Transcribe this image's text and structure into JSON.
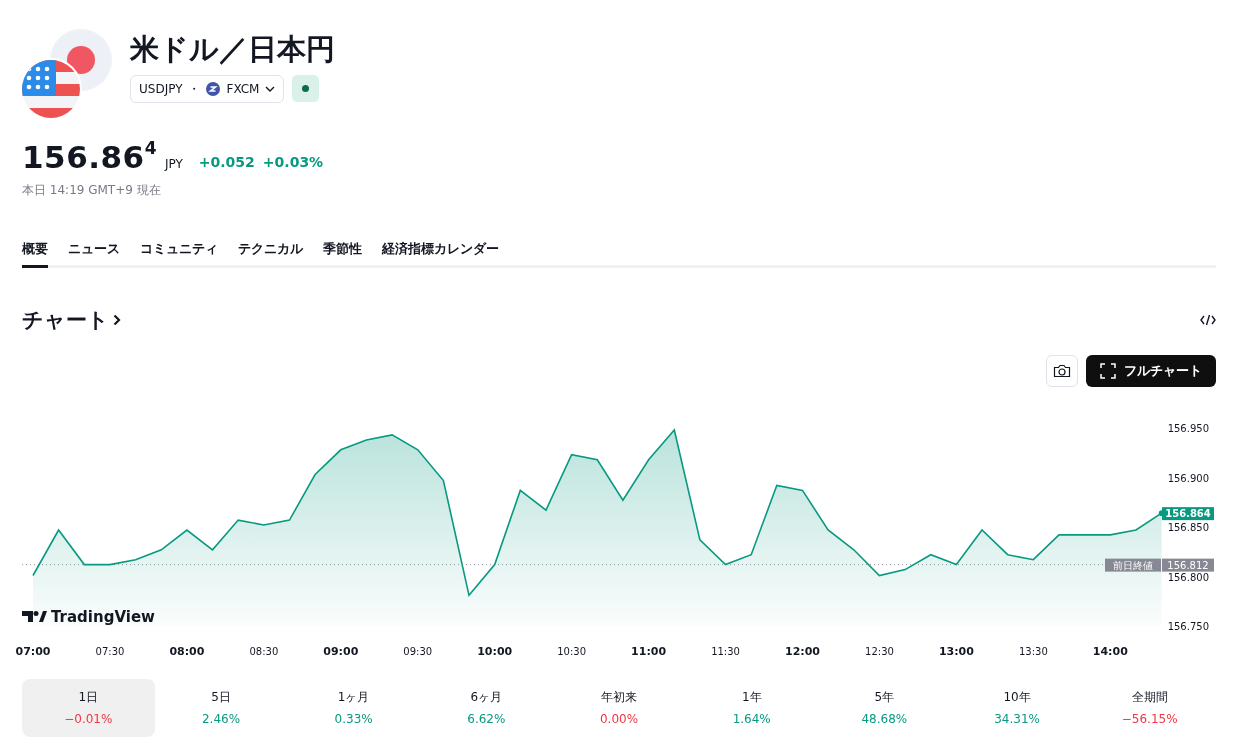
{
  "header": {
    "title": "米ドル／日本円",
    "symbol": "USDJPY",
    "separator": "・",
    "exchange": "FXCM"
  },
  "quote": {
    "price": "156.86$^{4}$",
    "currency": "JPY",
    "change": "+0.052",
    "change_percent": "+0.03%",
    "timestamp": "本日 14:19 GMT+9 現在"
  },
  "tabs": [
    {
      "label": "概要",
      "selected": true
    },
    {
      "label": "ニュース",
      "selected": false
    },
    {
      "label": "コミュニティ",
      "selected": false
    },
    {
      "label": "テクニカル",
      "selected": false
    },
    {
      "label": "季節性",
      "selected": false
    },
    {
      "label": "経済指標カレンダー",
      "selected": false
    }
  ],
  "chart_section": {
    "title": "チャート",
    "fullchart_button": "フルチャート",
    "logo_text": "TradingView",
    "price_tags": [
      {
        "kind": "last",
        "value": "156.864"
      },
      {
        "kind": "previous_close",
        "label": "前日終値",
        "value": "156.812"
      }
    ],
    "chart_data": {
      "type": "area",
      "categories": [
        "07:00",
        null,
        null,
        "07:30",
        null,
        null,
        "08:00",
        null,
        null,
        "08:30",
        null,
        null,
        "09:00",
        null,
        null,
        "09:30",
        null,
        null,
        "10:00",
        null,
        null,
        "10:30",
        null,
        null,
        "11:00",
        null,
        null,
        "11:30",
        null,
        null,
        "12:00",
        null,
        null,
        "12:30",
        null,
        null,
        "13:00",
        null,
        null,
        "13:30",
        null,
        null,
        "14:00",
        null,
        null
      ],
      "series": [
        {
          "color": "#089981",
          "values": [
            156.801,
            156.847,
            156.812,
            156.812,
            156.817,
            156.827,
            156.847,
            156.827,
            156.857,
            156.852,
            156.857,
            156.903,
            156.928,
            156.938,
            156.943,
            156.928,
            156.897,
            156.781,
            156.812,
            156.887,
            156.867,
            156.923,
            156.918,
            156.877,
            156.918,
            156.948,
            156.837,
            156.812,
            156.822,
            156.892,
            156.887,
            156.847,
            156.827,
            156.801,
            156.807,
            156.822,
            156.812,
            156.847,
            156.822,
            156.817,
            156.842,
            156.842,
            156.842,
            156.847,
            156.864
          ]
        }
      ],
      "ylim": [
        156.75,
        156.95
      ],
      "ref_lines": [
        {
          "axis": "y",
          "value": 156.812
        }
      ],
      "yticks": [
        {
          "value": 156.95,
          "label": "156.950"
        },
        {
          "value": 156.9,
          "label": "156.900"
        },
        {
          "value": 156.85,
          "label": "156.850"
        },
        {
          "value": 156.8,
          "label": "156.800"
        },
        {
          "value": 156.75,
          "label": "156.750"
        }
      ]
    }
  },
  "periods": [
    {
      "label": "1日",
      "change": "−0.01%",
      "color": "#f23645",
      "selected": true
    },
    {
      "label": "5日",
      "change": "2.46%",
      "color": "#089981",
      "selected": false
    },
    {
      "label": "1ヶ月",
      "change": "0.33%",
      "color": "#089981",
      "selected": false
    },
    {
      "label": "6ヶ月",
      "change": "6.62%",
      "color": "#089981",
      "selected": false
    },
    {
      "label": "年初来",
      "change": "0.00%",
      "color": "#f23645",
      "selected": false
    },
    {
      "label": "1年",
      "change": "1.64%",
      "color": "#089981",
      "selected": false
    },
    {
      "label": "5年",
      "change": "48.68%",
      "color": "#089981",
      "selected": false
    },
    {
      "label": "10年",
      "change": "34.31%",
      "color": "#089981",
      "selected": false
    },
    {
      "label": "全期間",
      "change": "−56.15%",
      "color": "#f23645",
      "selected": false
    }
  ]
}
